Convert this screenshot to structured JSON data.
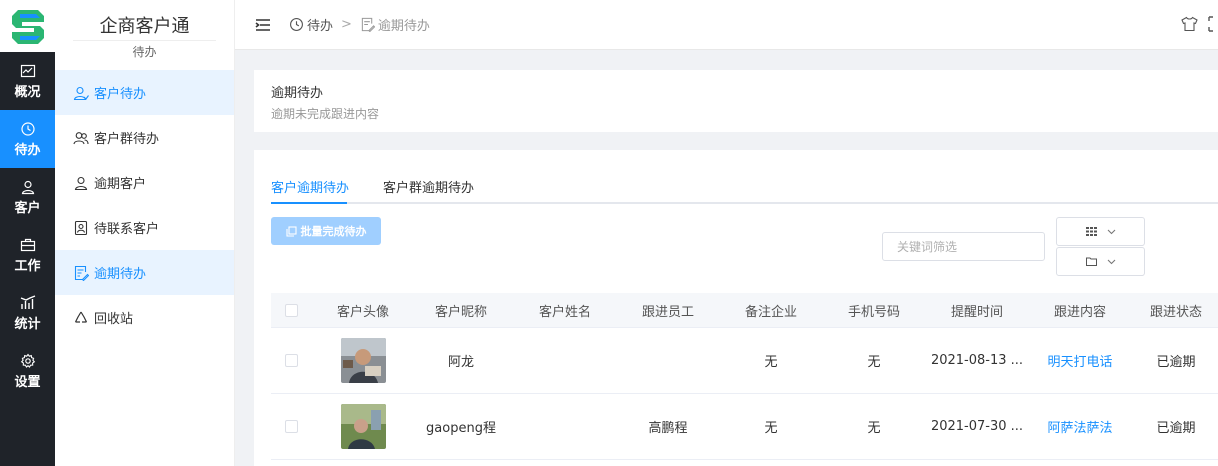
{
  "app": {
    "title": "企商客户通",
    "subtitle": "待办"
  },
  "rail": [
    {
      "label": "概况",
      "icon": "chart-icon",
      "active": false
    },
    {
      "label": "待办",
      "icon": "clock-icon",
      "active": true
    },
    {
      "label": "客户",
      "icon": "user-icon",
      "active": false
    },
    {
      "label": "工作",
      "icon": "briefcase-icon",
      "active": false
    },
    {
      "label": "统计",
      "icon": "stats-icon",
      "active": false
    },
    {
      "label": "设置",
      "icon": "gear-icon",
      "active": false
    }
  ],
  "sidebar": [
    {
      "label": "客户待办",
      "icon": "user-icon",
      "active": true
    },
    {
      "label": "客户群待办",
      "icon": "group-icon",
      "active": false
    },
    {
      "label": "逾期客户",
      "icon": "user-icon",
      "active": false
    },
    {
      "label": "待联系客户",
      "icon": "contact-card-icon",
      "active": false
    },
    {
      "label": "逾期待办",
      "icon": "doc-edit-icon",
      "active": true
    },
    {
      "label": "回收站",
      "icon": "recycle-icon",
      "active": false
    }
  ],
  "breadcrumb": {
    "first": "待办",
    "separator": ">",
    "second": "逾期待办"
  },
  "header": {
    "title": "逾期待办",
    "subtitle": "逾期未完成跟进内容"
  },
  "tabs": [
    {
      "label": "客户逾期待办",
      "active": true
    },
    {
      "label": "客户群逾期待办",
      "active": false
    }
  ],
  "toolbar": {
    "bulk_label": "批量完成待办",
    "search_placeholder": "关键词筛选"
  },
  "table": {
    "columns": [
      "客户头像",
      "客户昵称",
      "客户姓名",
      "跟进员工",
      "备注企业",
      "手机号码",
      "提醒时间",
      "跟进内容",
      "跟进状态"
    ],
    "rows": [
      {
        "nickname": "阿龙",
        "name": "",
        "staff": "",
        "company": "无",
        "phone": "无",
        "time": "2021-08-13 ...",
        "content": "明天打电话",
        "status": "已逾期"
      },
      {
        "nickname": "gaopeng程",
        "name": "",
        "staff": "高鹏程",
        "company": "无",
        "phone": "无",
        "time": "2021-07-30 ...",
        "content": "阿萨法萨法",
        "status": "已逾期"
      }
    ]
  },
  "colors": {
    "accent": "#1890ff",
    "rail_bg": "#1f2329",
    "active_bg": "#e8f3ff",
    "button_disabled": "#a0cfff"
  }
}
